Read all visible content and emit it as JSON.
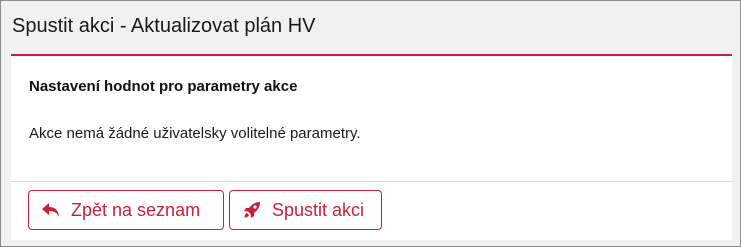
{
  "dialog": {
    "title": "Spustit akci - Aktualizovat plán HV"
  },
  "body": {
    "heading": "Nastavení hodnot pro parametry akce",
    "message": "Akce nemá žádné uživatelsky volitelné parametry."
  },
  "footer": {
    "back_button": {
      "label": "Zpět na seznam",
      "icon": "reply-arrow-icon"
    },
    "run_button": {
      "label": "Spustit akci",
      "icon": "rocket-icon"
    }
  },
  "colors": {
    "accent": "#c8203a",
    "header_bg": "#f1f1f1",
    "body_bg": "#ffffff"
  }
}
